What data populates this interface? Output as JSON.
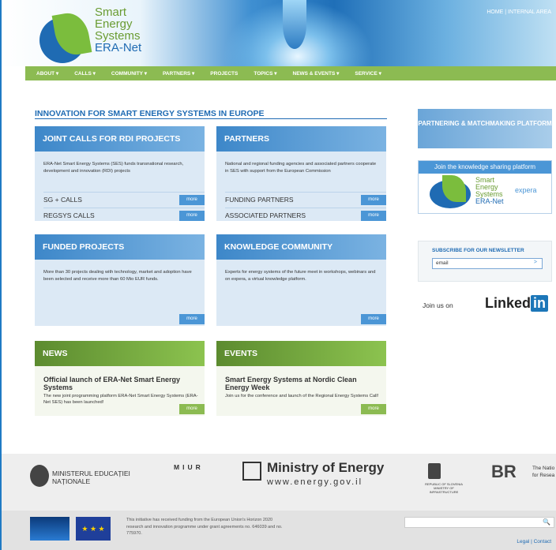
{
  "header": {
    "logo_line1": "Smart",
    "logo_line2": "Energy",
    "logo_line3": "Systems",
    "logo_line4": "ERA-Net",
    "toplinks": "HOME | INTERNAL AREA"
  },
  "nav": [
    "ABOUT ▾",
    "CALLS ▾",
    "COMMUNITY ▾",
    "PARTNERS ▾",
    "PROJECTS",
    "TOPICS ▾",
    "NEWS & EVENTS ▾",
    "SERVICE ▾"
  ],
  "main": {
    "title": "INNOVATION FOR SMART ENERGY SYSTEMS IN EUROPE",
    "joint_calls": {
      "title": "JOINT CALLS FOR RDI PROJECTS",
      "desc": "ERA-Net Smart Energy Systems (SES) funds transnational research, development and innovation (RDI) projects",
      "row1": "SG + CALLS",
      "row2": "REGSYS CALLS"
    },
    "partners": {
      "title": "PARTNERS",
      "desc": "National and regional funding agencies and associated partners cooperate in SES with support from the European Commission",
      "row1": "FUNDING PARTNERS",
      "row2": "ASSOCIATED PARTNERS"
    },
    "funded": {
      "title": "FUNDED PROJECTS",
      "desc": "More than 30 projects dealing with technology, market and adoption have been selected and receive more than 60 Mio EUR funds."
    },
    "knowledge": {
      "title": "KNOWLEDGE COMMUNITY",
      "desc": "Experts for energy systems of the future meet in workshops, webinars and on expera, a virtual knowledge platform."
    },
    "news": {
      "title": "NEWS",
      "headline": "Official launch of ERA-Net Smart Energy Systems",
      "desc": "The new joint programming platform ERA-Net Smart Energy Systems (ERA-Net SES) has been launched!"
    },
    "events": {
      "title": "EVENTS",
      "headline": "Smart Energy Systems at Nordic Clean Energy Week",
      "desc": "Join us for the conference and launch of the Regional Energy Systems Call!"
    },
    "more": "more"
  },
  "sidebar": {
    "pm_text": "PARTNERING & MATCHMAKING PLATFORM",
    "ks_title": "Join the knowledge sharing platform",
    "ks_logo_1": "Smart",
    "ks_logo_2": "Energy",
    "ks_logo_3": "Systems",
    "ks_logo_4": "ERA-Net",
    "ks_expera": "expera",
    "newsletter_title": "SUBSCRIBE FOR OUR NEWSLETTER",
    "newsletter_placeholder": "email",
    "newsletter_go": ">",
    "linkedin_text": "Join us on",
    "linkedin_brand": "Linked",
    "linkedin_in": "in"
  },
  "footer": {
    "p1": "MINISTERUL EDUCAȚIEI NAȚIONALE",
    "p2": "MIUR",
    "p3": "Ministry of Energy",
    "p3_sub": "www.energy.gov.il",
    "p4": "REPUBLIC OF SLOVENIA MINISTRY OF INFRASTRUCTURE",
    "p5": "The Natio for Resea",
    "funding_text": "This initiative has received funding from the European Union's Horizon 2020 research and innovation programme under grant agreements no. 646039 and no. 775970.",
    "links": "Legal | Contact"
  }
}
